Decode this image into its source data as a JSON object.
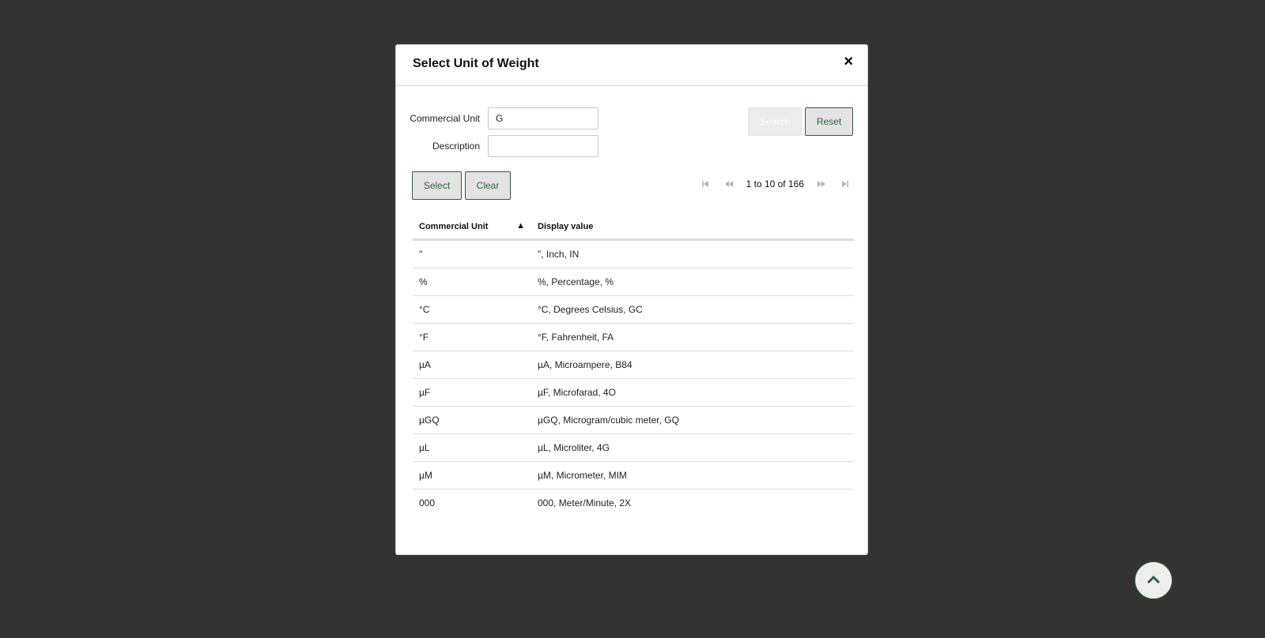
{
  "modal": {
    "title": "Select Unit of Weight",
    "close_glyph": "×"
  },
  "filters": {
    "commercial_unit_label": "Commercial Unit",
    "commercial_unit_value": "G",
    "description_label": "Description",
    "description_value": ""
  },
  "buttons": {
    "search": "Search",
    "reset": "Reset",
    "select": "Select",
    "clear": "Clear"
  },
  "pager": {
    "text": "1 to 10 of 166",
    "first_icon": "first-page-icon",
    "prev_icon": "previous-page-icon",
    "next_icon": "next-page-icon",
    "last_icon": "last-page-icon"
  },
  "grid": {
    "columns": [
      "Commercial Unit",
      "Display value"
    ],
    "sort_indicator": "▲",
    "rows": [
      {
        "unit": "\"",
        "display": "\", Inch, IN"
      },
      {
        "unit": "%",
        "display": "%, Percentage, %"
      },
      {
        "unit": "°C",
        "display": "°C, Degrees Celsius, GC"
      },
      {
        "unit": "°F",
        "display": "°F, Fahrenheit, FA"
      },
      {
        "unit": "µA",
        "display": "µA, Microampere, B84"
      },
      {
        "unit": "µF",
        "display": "µF, Microfarad, 4O"
      },
      {
        "unit": "µGQ",
        "display": "µGQ, Microgram/cubic meter, GQ"
      },
      {
        "unit": "µL",
        "display": "µL, Microliter, 4G"
      },
      {
        "unit": "µM",
        "display": "µM, Micrometer, MIM"
      },
      {
        "unit": "000",
        "display": "000, Meter/Minute, 2X"
      }
    ]
  },
  "scroll_top_icon": "chevron-up-icon",
  "colors": {
    "backdrop": "#333333",
    "accent": "#2f5f3a",
    "button_bg": "#e3e3e3"
  }
}
